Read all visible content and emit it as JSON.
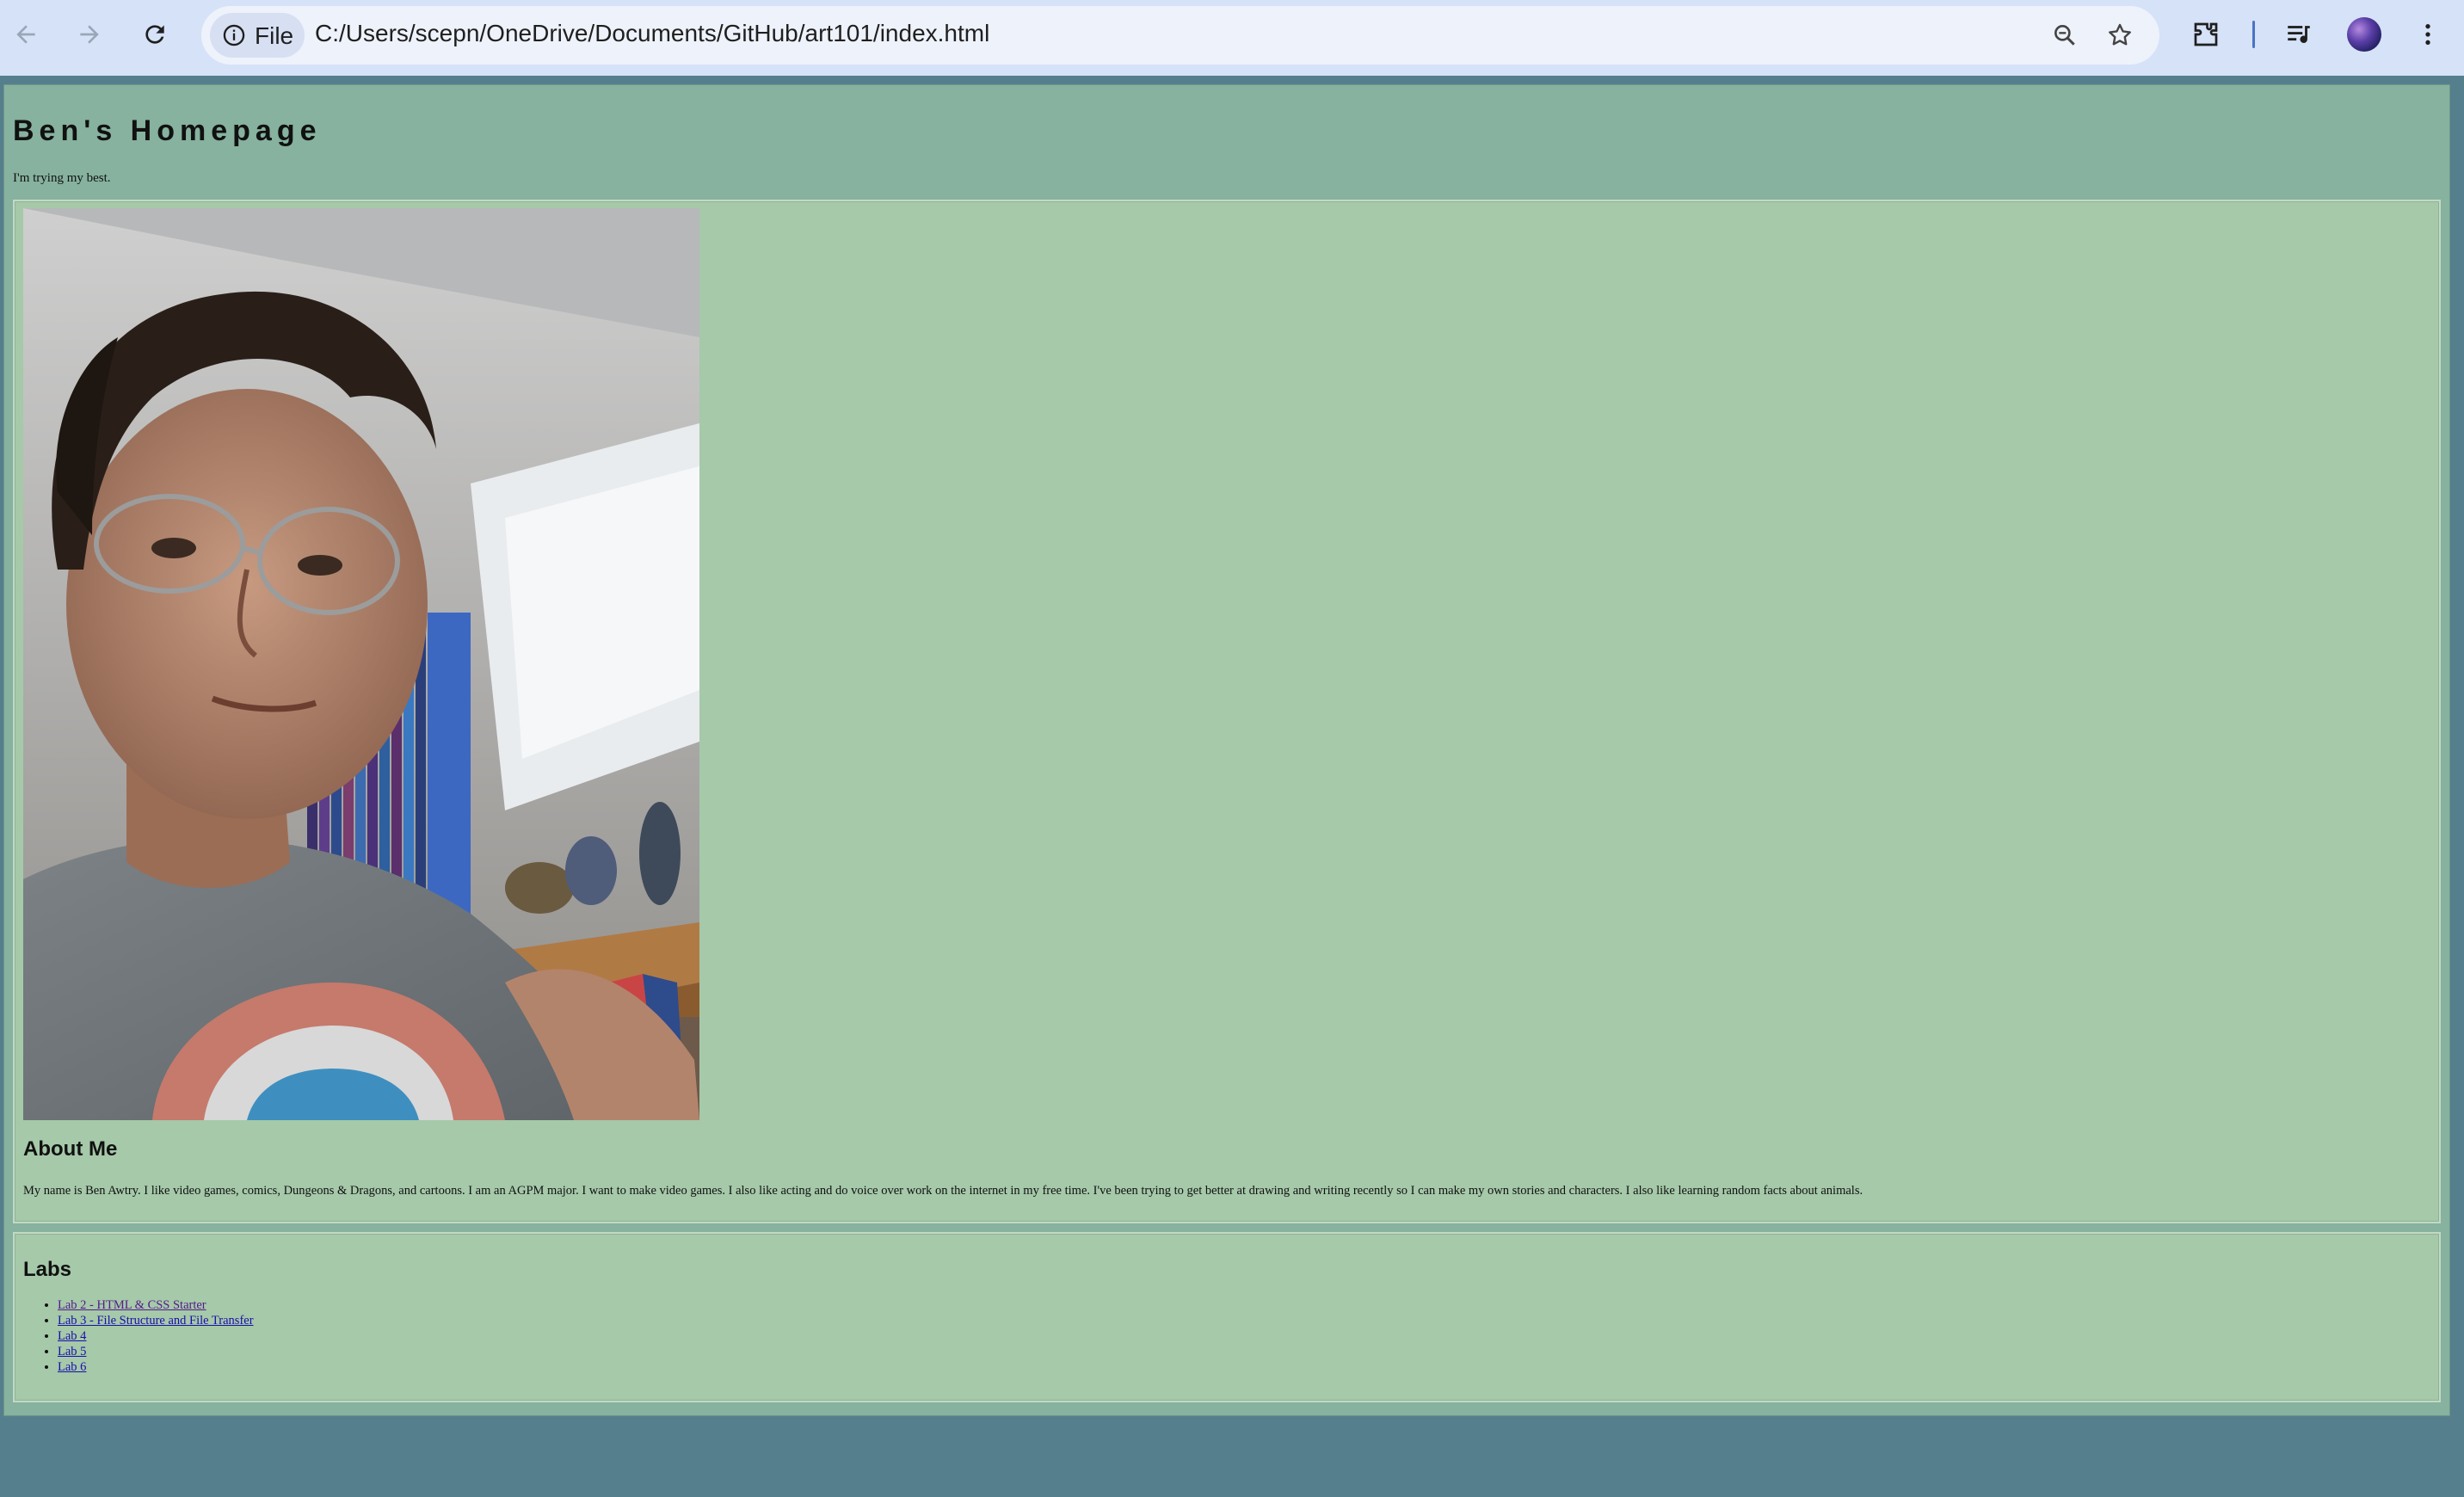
{
  "browser": {
    "site_chip_label": "File",
    "url": "C:/Users/scepn/OneDrive/Documents/GitHub/art101/index.html",
    "icons": [
      "back-arrow-icon",
      "forward-arrow-icon",
      "reload-icon",
      "info-icon",
      "zoom-icon",
      "star-icon",
      "extensions-icon",
      "media-controls-icon",
      "profile-avatar",
      "more-menu-icon"
    ]
  },
  "page": {
    "title": "Ben's Homepage",
    "tagline": "I'm trying my best.",
    "about": {
      "heading": "About Me",
      "text": "My name is Ben Awtry. I like video games, comics, Dungeons & Dragons, and cartoons. I am an AGPM major. I want to make video games. I also like acting and do voice over work on the internet in my free time. I've been trying to get better at drawing and writing recently so I can make my own stories and characters. I also like learning random facts about animals."
    },
    "labs": {
      "heading": "Labs",
      "items": [
        {
          "label": "Lab 2 - HTML & CSS Starter"
        },
        {
          "label": "Lab 3 - File Structure and File Transfer"
        },
        {
          "label": "Lab 4"
        },
        {
          "label": "Lab 5"
        },
        {
          "label": "Lab 6"
        }
      ]
    }
  },
  "colors": {
    "page_background": "#557f8d",
    "header_background": "#86b29f",
    "section_background": "#a5c9a9",
    "browser_chrome": "#d6e2f7"
  }
}
